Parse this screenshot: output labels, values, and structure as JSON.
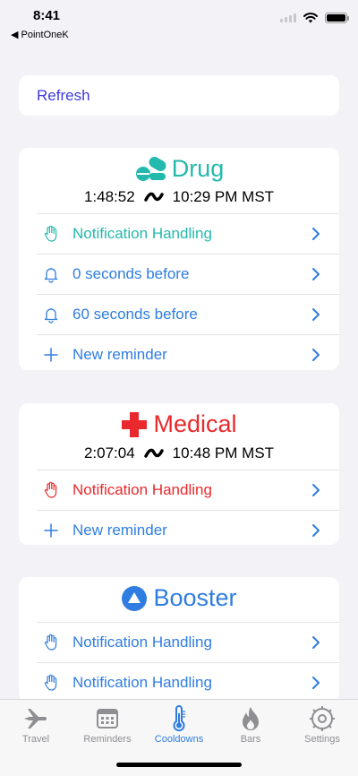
{
  "status": {
    "time": "8:41",
    "back_app": "◀ PointOneK"
  },
  "refresh": {
    "label": "Refresh"
  },
  "cooldowns": [
    {
      "title": "Drug",
      "color": "#23b9ad",
      "timer": "1:48:52",
      "end_time": "10:29 PM MST",
      "rows": [
        {
          "label": "Notification Handling",
          "color": "#23b9ad"
        },
        {
          "label": "0 seconds before",
          "color": "#2f7de1"
        },
        {
          "label": "60 seconds before",
          "color": "#2f7de1"
        },
        {
          "label": "New reminder",
          "color": "#2f7de1"
        }
      ]
    },
    {
      "title": "Medical",
      "color": "#e9292b",
      "timer": "2:07:04",
      "end_time": "10:48 PM MST",
      "rows": [
        {
          "label": "Notification Handling",
          "color": "#e9292b"
        },
        {
          "label": "New reminder",
          "color": "#2f7de1"
        }
      ]
    },
    {
      "title": "Booster",
      "color": "#2f7de1",
      "rows": [
        {
          "label": "Notification Handling",
          "color": "#2f7de1"
        },
        {
          "label": "Notification Handling",
          "color": "#2f7de1"
        }
      ]
    }
  ],
  "tabs": [
    {
      "label": "Travel",
      "icon": "airplane-icon",
      "active": false
    },
    {
      "label": "Reminders",
      "icon": "calendar-icon",
      "active": false
    },
    {
      "label": "Cooldowns",
      "icon": "thermometer-icon",
      "active": true
    },
    {
      "label": "Bars",
      "icon": "flame-icon",
      "active": false
    },
    {
      "label": "Settings",
      "icon": "gear-icon",
      "active": false
    }
  ]
}
